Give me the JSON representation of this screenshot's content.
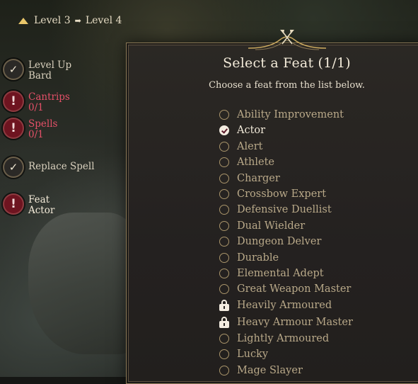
{
  "breadcrumb": {
    "from": "Level 3",
    "to": "Level 4"
  },
  "steps": [
    {
      "line1": "Level Up",
      "line2": "Bard",
      "status": "done"
    },
    {
      "line1": "Cantrips",
      "line2": "0/1",
      "status": "warning"
    },
    {
      "line1": "Spells",
      "line2": "0/1",
      "status": "warning"
    },
    {
      "line1": "Replace Spell",
      "line2": "",
      "status": "done"
    },
    {
      "line1": "Feat",
      "line2": "Actor",
      "status": "warning-active"
    }
  ],
  "panel": {
    "title": "Select a Feat (1/1)",
    "subtitle": "Choose a feat from the list below."
  },
  "feats": [
    {
      "name": "Ability Improvement",
      "state": "unselected"
    },
    {
      "name": "Actor",
      "state": "selected"
    },
    {
      "name": "Alert",
      "state": "unselected"
    },
    {
      "name": "Athlete",
      "state": "unselected"
    },
    {
      "name": "Charger",
      "state": "unselected"
    },
    {
      "name": "Crossbow Expert",
      "state": "unselected"
    },
    {
      "name": "Defensive Duellist",
      "state": "unselected"
    },
    {
      "name": "Dual Wielder",
      "state": "unselected"
    },
    {
      "name": "Dungeon Delver",
      "state": "unselected"
    },
    {
      "name": "Durable",
      "state": "unselected"
    },
    {
      "name": "Elemental Adept",
      "state": "unselected"
    },
    {
      "name": "Great Weapon Master",
      "state": "unselected"
    },
    {
      "name": "Heavily Armoured",
      "state": "locked"
    },
    {
      "name": "Heavy Armour Master",
      "state": "locked"
    },
    {
      "name": "Lightly Armoured",
      "state": "unselected"
    },
    {
      "name": "Lucky",
      "state": "unselected"
    },
    {
      "name": "Mage Slayer",
      "state": "unselected"
    }
  ],
  "icons": {
    "breadcrumb_up": "level-up-arrow-icon",
    "breadcrumb_next": "right-arrow-icon",
    "crest": "crossed-axes-crest-icon",
    "done": "checkmark-icon",
    "warning": "exclamation-icon",
    "locked": "padlock-icon"
  },
  "colors": {
    "accent_gold": "#e9c66a",
    "alert_red": "#e45068",
    "text_light": "#f2ead9",
    "text_muted": "#b9a989"
  }
}
